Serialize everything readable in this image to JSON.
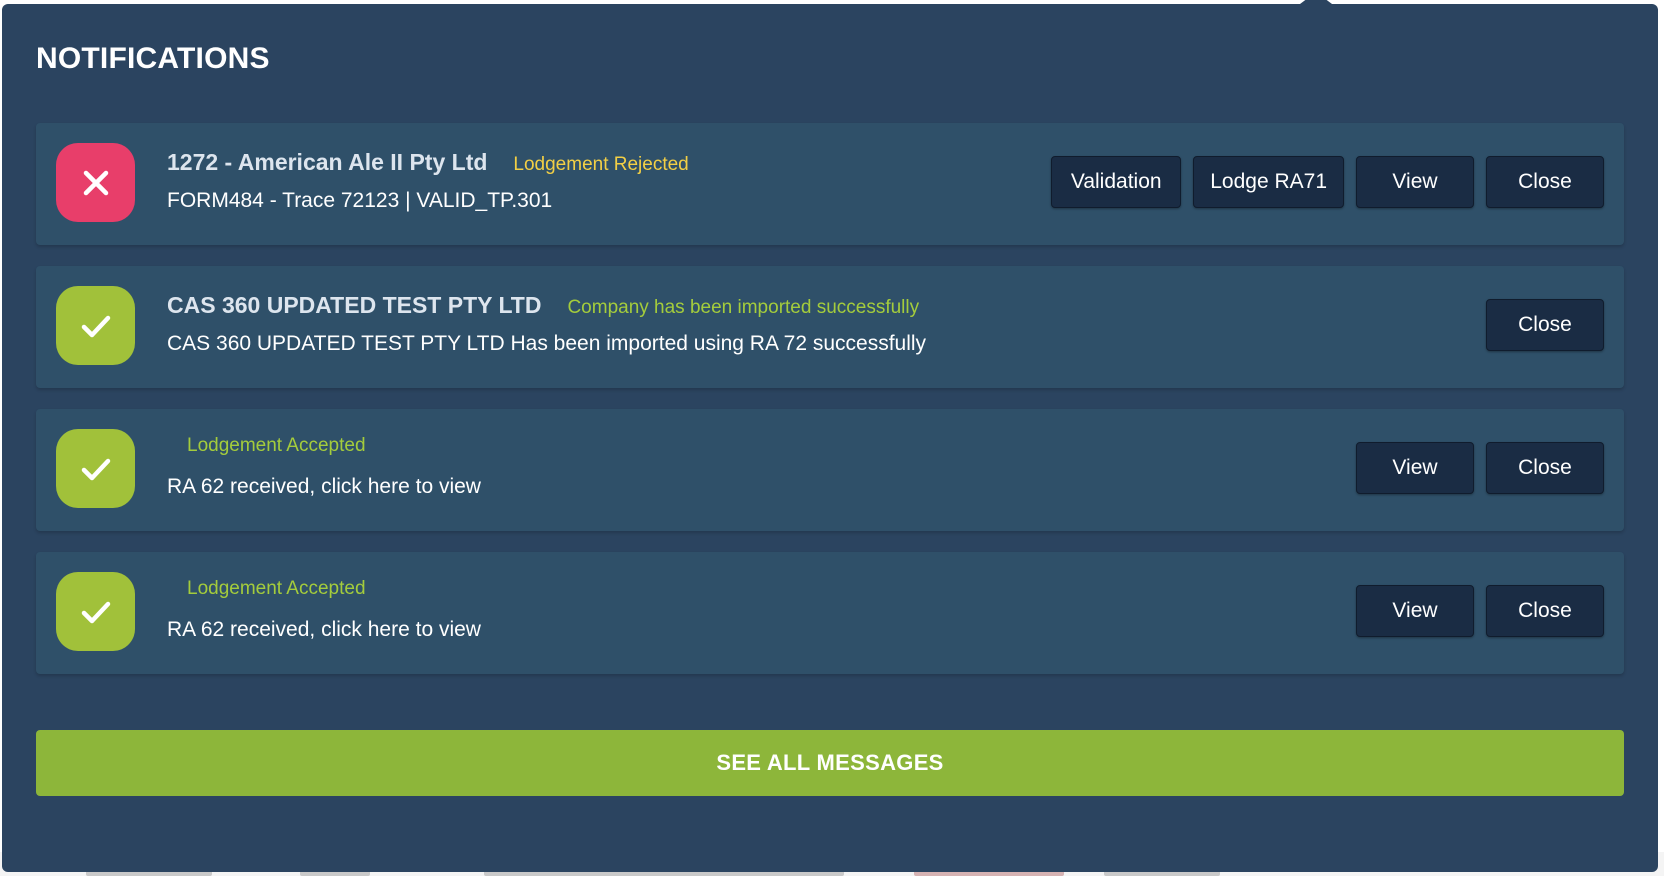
{
  "panel": {
    "title": "NOTIFICATIONS",
    "see_all_label": "SEE ALL MESSAGES"
  },
  "colors": {
    "panel_bg": "#2b4460",
    "card_bg": "#2f5069",
    "error": "#e83e6a",
    "success": "#a1c13a",
    "rejected_text": "#f2cf45",
    "accepted_text": "#a4cc3c",
    "button_bg": "#1a2c44",
    "see_all_bg": "#8db63a"
  },
  "notifications": [
    {
      "icon": "x-icon",
      "title": "1272 - American Ale II Pty Ltd",
      "status": "Lodgement Rejected",
      "message": "FORM484 - Trace 72123 | VALID_TP.301",
      "actions": [
        "Validation",
        "Lodge RA71",
        "View",
        "Close"
      ]
    },
    {
      "icon": "check-icon",
      "title": "CAS 360 UPDATED TEST PTY LTD",
      "status": "Company has been imported successfully",
      "message": "CAS 360 UPDATED TEST PTY LTD Has been imported using RA 72 successfully",
      "actions": [
        "Close"
      ]
    },
    {
      "icon": "check-icon",
      "title": "",
      "status": "Lodgement Accepted",
      "message": "RA 62 received, click here to view",
      "actions": [
        "View",
        "Close"
      ]
    },
    {
      "icon": "check-icon",
      "title": "",
      "status": "Lodgement Accepted",
      "message": "RA 62 received, click here to view",
      "actions": [
        "View",
        "Close"
      ]
    }
  ]
}
